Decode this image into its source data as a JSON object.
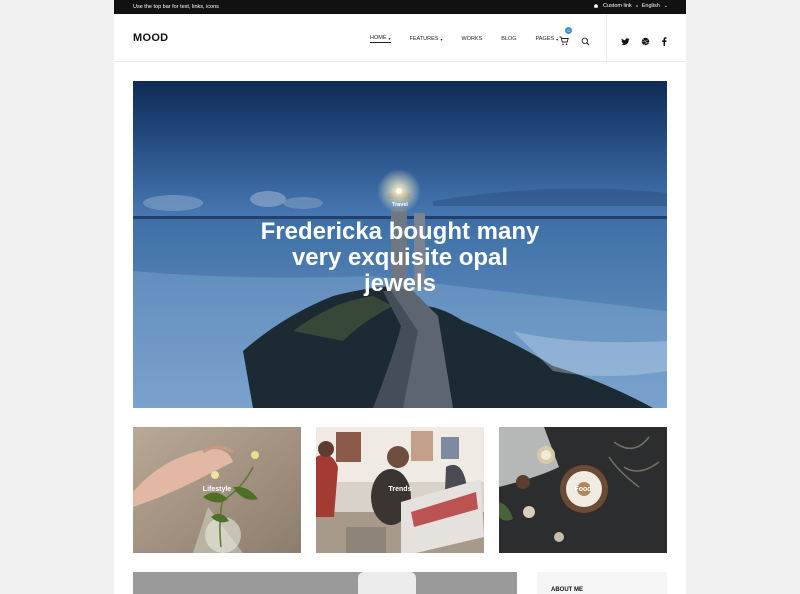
{
  "topbar": {
    "text": "Use the top bar for text, links, icons",
    "custom_link": "Custom link",
    "language": "English"
  },
  "header": {
    "logo": "MOOD",
    "nav": [
      {
        "label": "HOME",
        "dropdown": true,
        "active": true
      },
      {
        "label": "FEATURES",
        "dropdown": true
      },
      {
        "label": "WORKS",
        "dropdown": false
      },
      {
        "label": "BLOG",
        "dropdown": false
      },
      {
        "label": "PAGES",
        "dropdown": true
      }
    ],
    "cart_count": "0",
    "icons": [
      "cart-icon",
      "search-icon",
      "twitter-icon",
      "dribbble-icon",
      "facebook-icon"
    ]
  },
  "hero": {
    "category": "Travel",
    "title": "Fredericka bought many very exquisite opal jewels"
  },
  "cards": [
    {
      "label": "Lifestyle"
    },
    {
      "label": "Trends"
    },
    {
      "label": "Food"
    }
  ],
  "sidebar": {
    "about_title": "ABOUT ME"
  },
  "colors": {
    "accent": "#3f8fd6",
    "topbar_bg": "#111111",
    "page_bg": "#f1f1f1"
  }
}
